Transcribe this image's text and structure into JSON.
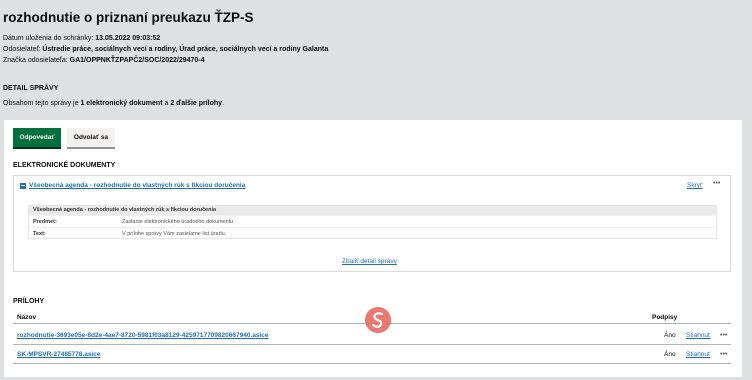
{
  "page_title": "rozhodnutie o priznaní preukazu ŤZP-S",
  "meta": {
    "date_label": "Dátum uloženia do schránky:",
    "date_value": "13.05.2022 09:03:52",
    "sender_label": "Odosielateľ:",
    "sender_value": "Ústredie práce, sociálnych vecí a rodiny, Úrad práce, sociálnych vecí a rodiny Galanta",
    "ref_label": "Značka odosielateľa:",
    "ref_value": "GA1/OPPNKŤZPAPČ2/SOC/2022/29470-4"
  },
  "detail": {
    "heading": "DETAIL SPRÁVY",
    "summary_prefix": "Obsahom tejto správy je",
    "summary_docs": "1 elektronický dokument",
    "summary_mid": "a",
    "summary_atts": "2 ďalšie prílohy",
    "summary_end": "."
  },
  "actions": {
    "reply_label": "Odpovedať",
    "appeal_label": "Odvolať sa"
  },
  "documents": {
    "heading": "ELEKTRONICKÉ DOKUMENTY",
    "doc_title": "Všeobecná agenda - rozhodnutie do vlastných rúk s fikciou doručenia",
    "hide_label": "Skryť",
    "more_icon": "ellipsis-icon",
    "inner_title": "Všeobecná agenda - rozhodnutie do vlastných rúk s fikciou doručenia",
    "rows": [
      {
        "key": "Predmet:",
        "value": "Zaslanie elektronického úradného dokumentu"
      },
      {
        "key": "Text:",
        "value": "V prílohe správy Vám zasielame list úradu."
      }
    ],
    "collapse_label": "Zbaliť detail správy"
  },
  "attachments": {
    "heading": "PRÍLOHY",
    "col_name": "Názov",
    "col_signed": "Podpisy",
    "items": [
      {
        "name": "rozhodnutie-3693e05e-8d2e-4ae7-8720-5981f03a8129-4259717709820667940.asice",
        "signed": "Áno",
        "download": "Stiahnuť"
      },
      {
        "name": "SK-MPSVR-27485778.asice",
        "signed": "Áno",
        "download": "Stiahnuť"
      }
    ]
  },
  "colors": {
    "primary_button": "#00703c",
    "link": "#1d70b8",
    "background": "#dee0e2"
  }
}
